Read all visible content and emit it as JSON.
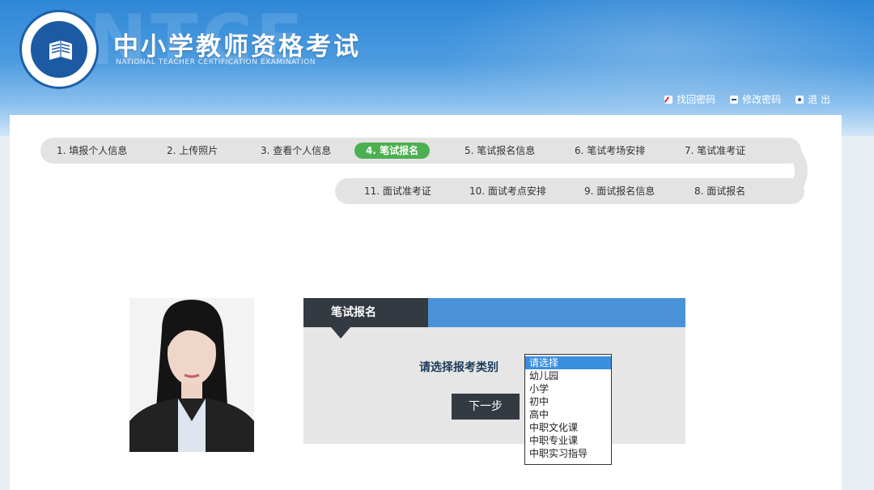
{
  "header": {
    "watermark": "NTCE",
    "title": "中小学教师资格考试",
    "subtitle": "NATIONAL TEACHER CERTIFICATION EXAMINATION",
    "nav": [
      {
        "label": "找回密码",
        "icon": "edit-icon"
      },
      {
        "label": "修改密码",
        "icon": "key-icon"
      },
      {
        "label": "退 出",
        "icon": "logout-icon"
      }
    ]
  },
  "steps": [
    {
      "label": "1. 填报个人信息",
      "active": false
    },
    {
      "label": "2. 上传照片",
      "active": false
    },
    {
      "label": "3. 查看个人信息",
      "active": false
    },
    {
      "label": "4. 笔试报名",
      "active": true
    },
    {
      "label": "5. 笔试报名信息",
      "active": false
    },
    {
      "label": "6. 笔试考场安排",
      "active": false
    },
    {
      "label": "7. 笔试准考证",
      "active": false
    },
    {
      "label": "8. 面试报名",
      "active": false
    },
    {
      "label": "9. 面试报名信息",
      "active": false
    },
    {
      "label": "10. 面试考点安排",
      "active": false
    },
    {
      "label": "11. 面试准考证",
      "active": false
    }
  ],
  "form": {
    "tab_label": "笔试报名",
    "category_label": "请选择报考类别",
    "next_button": "下一步",
    "category_options": [
      "请选择",
      "幼儿园",
      "小学",
      "初中",
      "高中",
      "中职文化课",
      "中职专业课",
      "中职实习指导"
    ],
    "selected_index": 0
  },
  "colors": {
    "banner": "#2f87d6",
    "active_step": "#4caf50",
    "form_header": "#4a93d8",
    "dark": "#333a42",
    "selected_option": "#3b8ee0"
  }
}
